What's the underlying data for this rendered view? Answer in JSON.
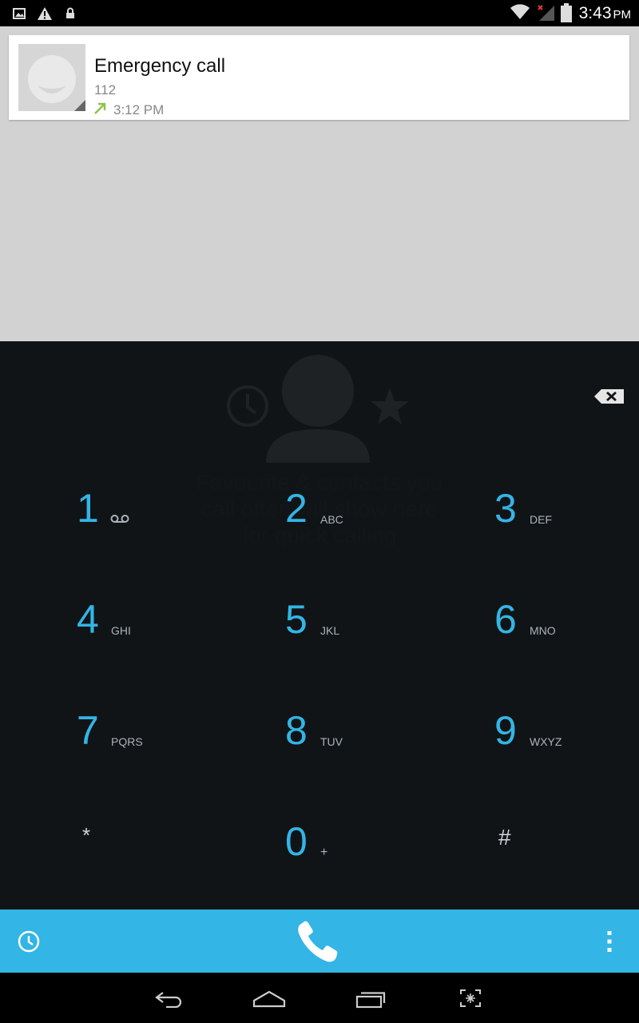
{
  "status_bar": {
    "time": "3:43",
    "ampm": "PM",
    "icons": [
      "image-icon",
      "warning-icon",
      "lock-icon",
      "wifi-icon",
      "signal-icon",
      "battery-icon"
    ]
  },
  "recent_call": {
    "name": "Emergency call",
    "number": "112",
    "time": "3:12 PM",
    "direction_icon": "outgoing-arrow-icon"
  },
  "empty_state": {
    "line1": "Favourite & contacts you",
    "line2": "call often will show here",
    "line3": "for quick calling"
  },
  "dialpad": {
    "keys": [
      {
        "digit": "1",
        "letters": "",
        "icon": "voicemail-icon"
      },
      {
        "digit": "2",
        "letters": "ABC"
      },
      {
        "digit": "3",
        "letters": "DEF"
      },
      {
        "digit": "4",
        "letters": "GHI"
      },
      {
        "digit": "5",
        "letters": "JKL"
      },
      {
        "digit": "6",
        "letters": "MNO"
      },
      {
        "digit": "7",
        "letters": "PQRS"
      },
      {
        "digit": "8",
        "letters": "TUV"
      },
      {
        "digit": "9",
        "letters": "WXYZ"
      },
      {
        "digit": "*",
        "letters": ""
      },
      {
        "digit": "0",
        "letters": "+"
      },
      {
        "digit": "#",
        "letters": ""
      }
    ]
  },
  "colors": {
    "accent": "#33b5e5",
    "dialpad_bg": "#111417",
    "recent_bg": "#d2d2d2",
    "call_arrow": "#8bc34a"
  }
}
